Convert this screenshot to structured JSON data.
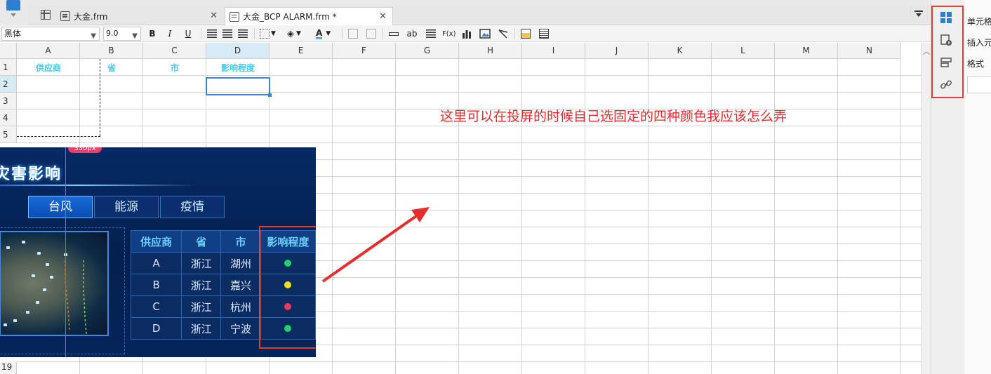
{
  "tabs": [
    {
      "label": "大金.frm"
    },
    {
      "label": "大金_BCP ALARM.frm *"
    }
  ],
  "toolbar": {
    "font": "黑体",
    "size": "9.0",
    "bold": "B",
    "italic": "I",
    "underline": "U",
    "text_ab": "ab",
    "fx": "F(x)"
  },
  "columns": [
    "A",
    "B",
    "C",
    "D",
    "E",
    "F",
    "G",
    "H",
    "I",
    "J",
    "K",
    "L",
    "M",
    "N"
  ],
  "selected_column": "D",
  "rows": [
    "1",
    "2",
    "3",
    "4",
    "5"
  ],
  "selected_row": "2",
  "last_row": "19",
  "header_cells": {
    "a1": "供应商",
    "b1": "省",
    "c1": "市",
    "d1": "影响程度"
  },
  "dashboard": {
    "title": "灾害影响",
    "px_badge": "330px",
    "tabs": [
      "台风",
      "能源",
      "疫情"
    ],
    "active_tab": "台风",
    "table_headers": [
      "供应商",
      "省",
      "市",
      "影响程度"
    ],
    "table_rows": [
      {
        "supplier": "A",
        "province": "浙江",
        "city": "湖州",
        "color": "#1fd36a"
      },
      {
        "supplier": "B",
        "province": "浙江",
        "city": "嘉兴",
        "color": "#f2e21b"
      },
      {
        "supplier": "C",
        "province": "浙江",
        "city": "杭州",
        "color": "#ef3b5a"
      },
      {
        "supplier": "D",
        "province": "浙江",
        "city": "宁波",
        "color": "#1fd36a"
      }
    ]
  },
  "annotation": "这里可以在投屏的时候自己选固定的四种颜色我应该怎么弄",
  "properties": {
    "cell_element": "单元格",
    "insert": "插入元",
    "format": "格式"
  },
  "colors": {
    "accent": "#3b84d8",
    "annotation": "#e52d2d",
    "header_text": "#4ac7e6"
  }
}
